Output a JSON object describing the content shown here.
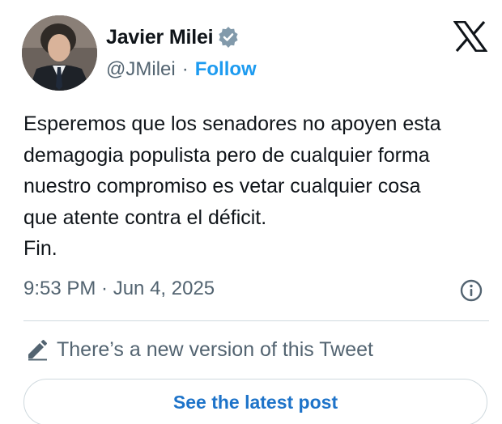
{
  "author": {
    "name": "Javier Milei",
    "handle": "@JMilei",
    "separator": "·",
    "follow_label": "Follow",
    "verified_icon": "verified-badge-icon",
    "avatar": "profile-photo"
  },
  "brand": {
    "logo_icon": "x-logo-icon"
  },
  "tweet": {
    "text": "Esperemos que los senadores no apoyen esta\ndemagogia populista pero de cualquier forma\nnuestro compromiso es vetar cualquier cosa\nque atente contra el déficit.\nFin.",
    "timestamp": "9:53 PM · Jun 4, 2025",
    "info_icon": "info-icon"
  },
  "notice": {
    "icon": "pencil-icon",
    "text": "There’s a new version of this Tweet"
  },
  "actions": {
    "latest_post_label": "See the latest post"
  },
  "colors": {
    "text_primary": "#0f1419",
    "text_secondary": "#536471",
    "accent": "#1d9bf0",
    "button_text": "#1d73c9",
    "border": "#cfd9de"
  }
}
